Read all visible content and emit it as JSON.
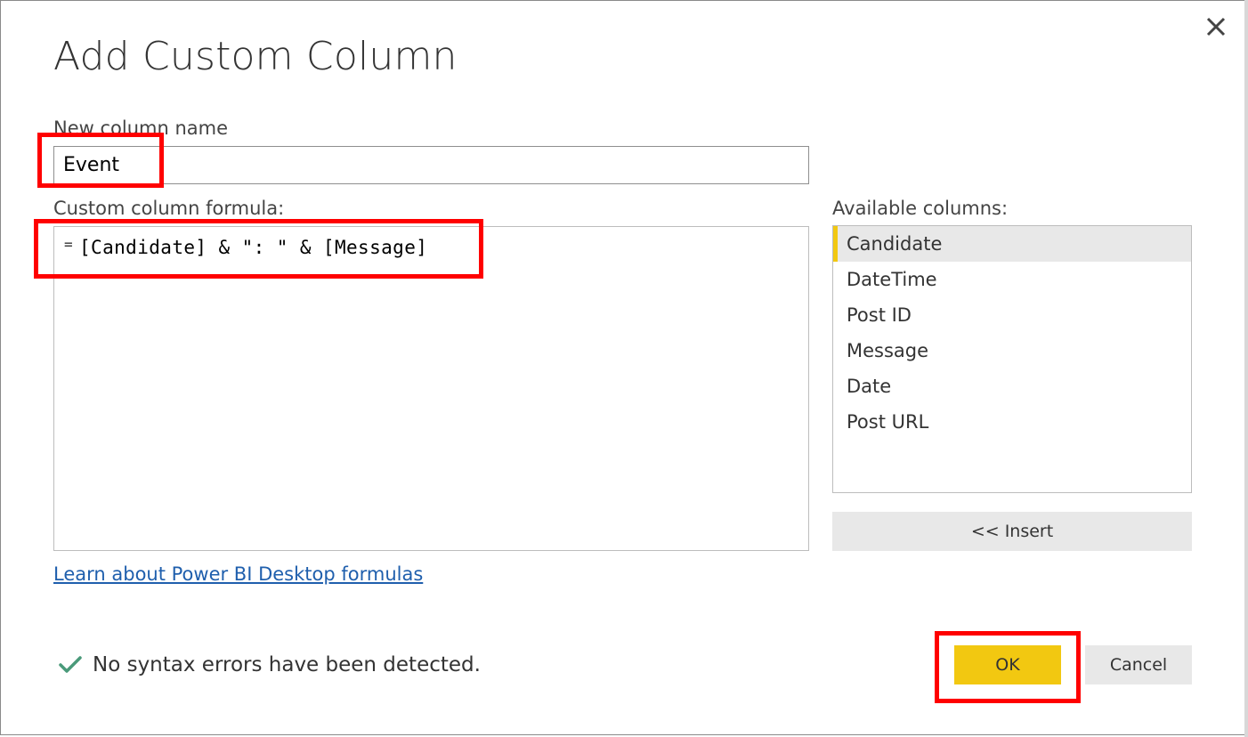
{
  "dialog": {
    "title": "Add Custom Column",
    "close_icon": "close-icon"
  },
  "new_column": {
    "label": "New column name",
    "value": "Event"
  },
  "formula": {
    "label": "Custom column formula:",
    "prefix": "=",
    "value": "[Candidate] & \": \" & [Message]"
  },
  "available_columns": {
    "label": "Available columns:",
    "items": [
      {
        "label": "Candidate",
        "selected": true
      },
      {
        "label": "DateTime",
        "selected": false
      },
      {
        "label": "Post ID",
        "selected": false
      },
      {
        "label": "Message",
        "selected": false
      },
      {
        "label": "Date",
        "selected": false
      },
      {
        "label": "Post URL",
        "selected": false
      }
    ],
    "insert_label": "<< Insert"
  },
  "learn_link": "Learn about Power BI Desktop formulas",
  "status": {
    "icon": "checkmark-icon",
    "text": "No syntax errors have been detected."
  },
  "buttons": {
    "ok": "OK",
    "cancel": "Cancel"
  },
  "colors": {
    "accent": "#f2c811",
    "highlight": "#ff0000",
    "link": "#1f5fad",
    "check": "#4a9a7a"
  }
}
